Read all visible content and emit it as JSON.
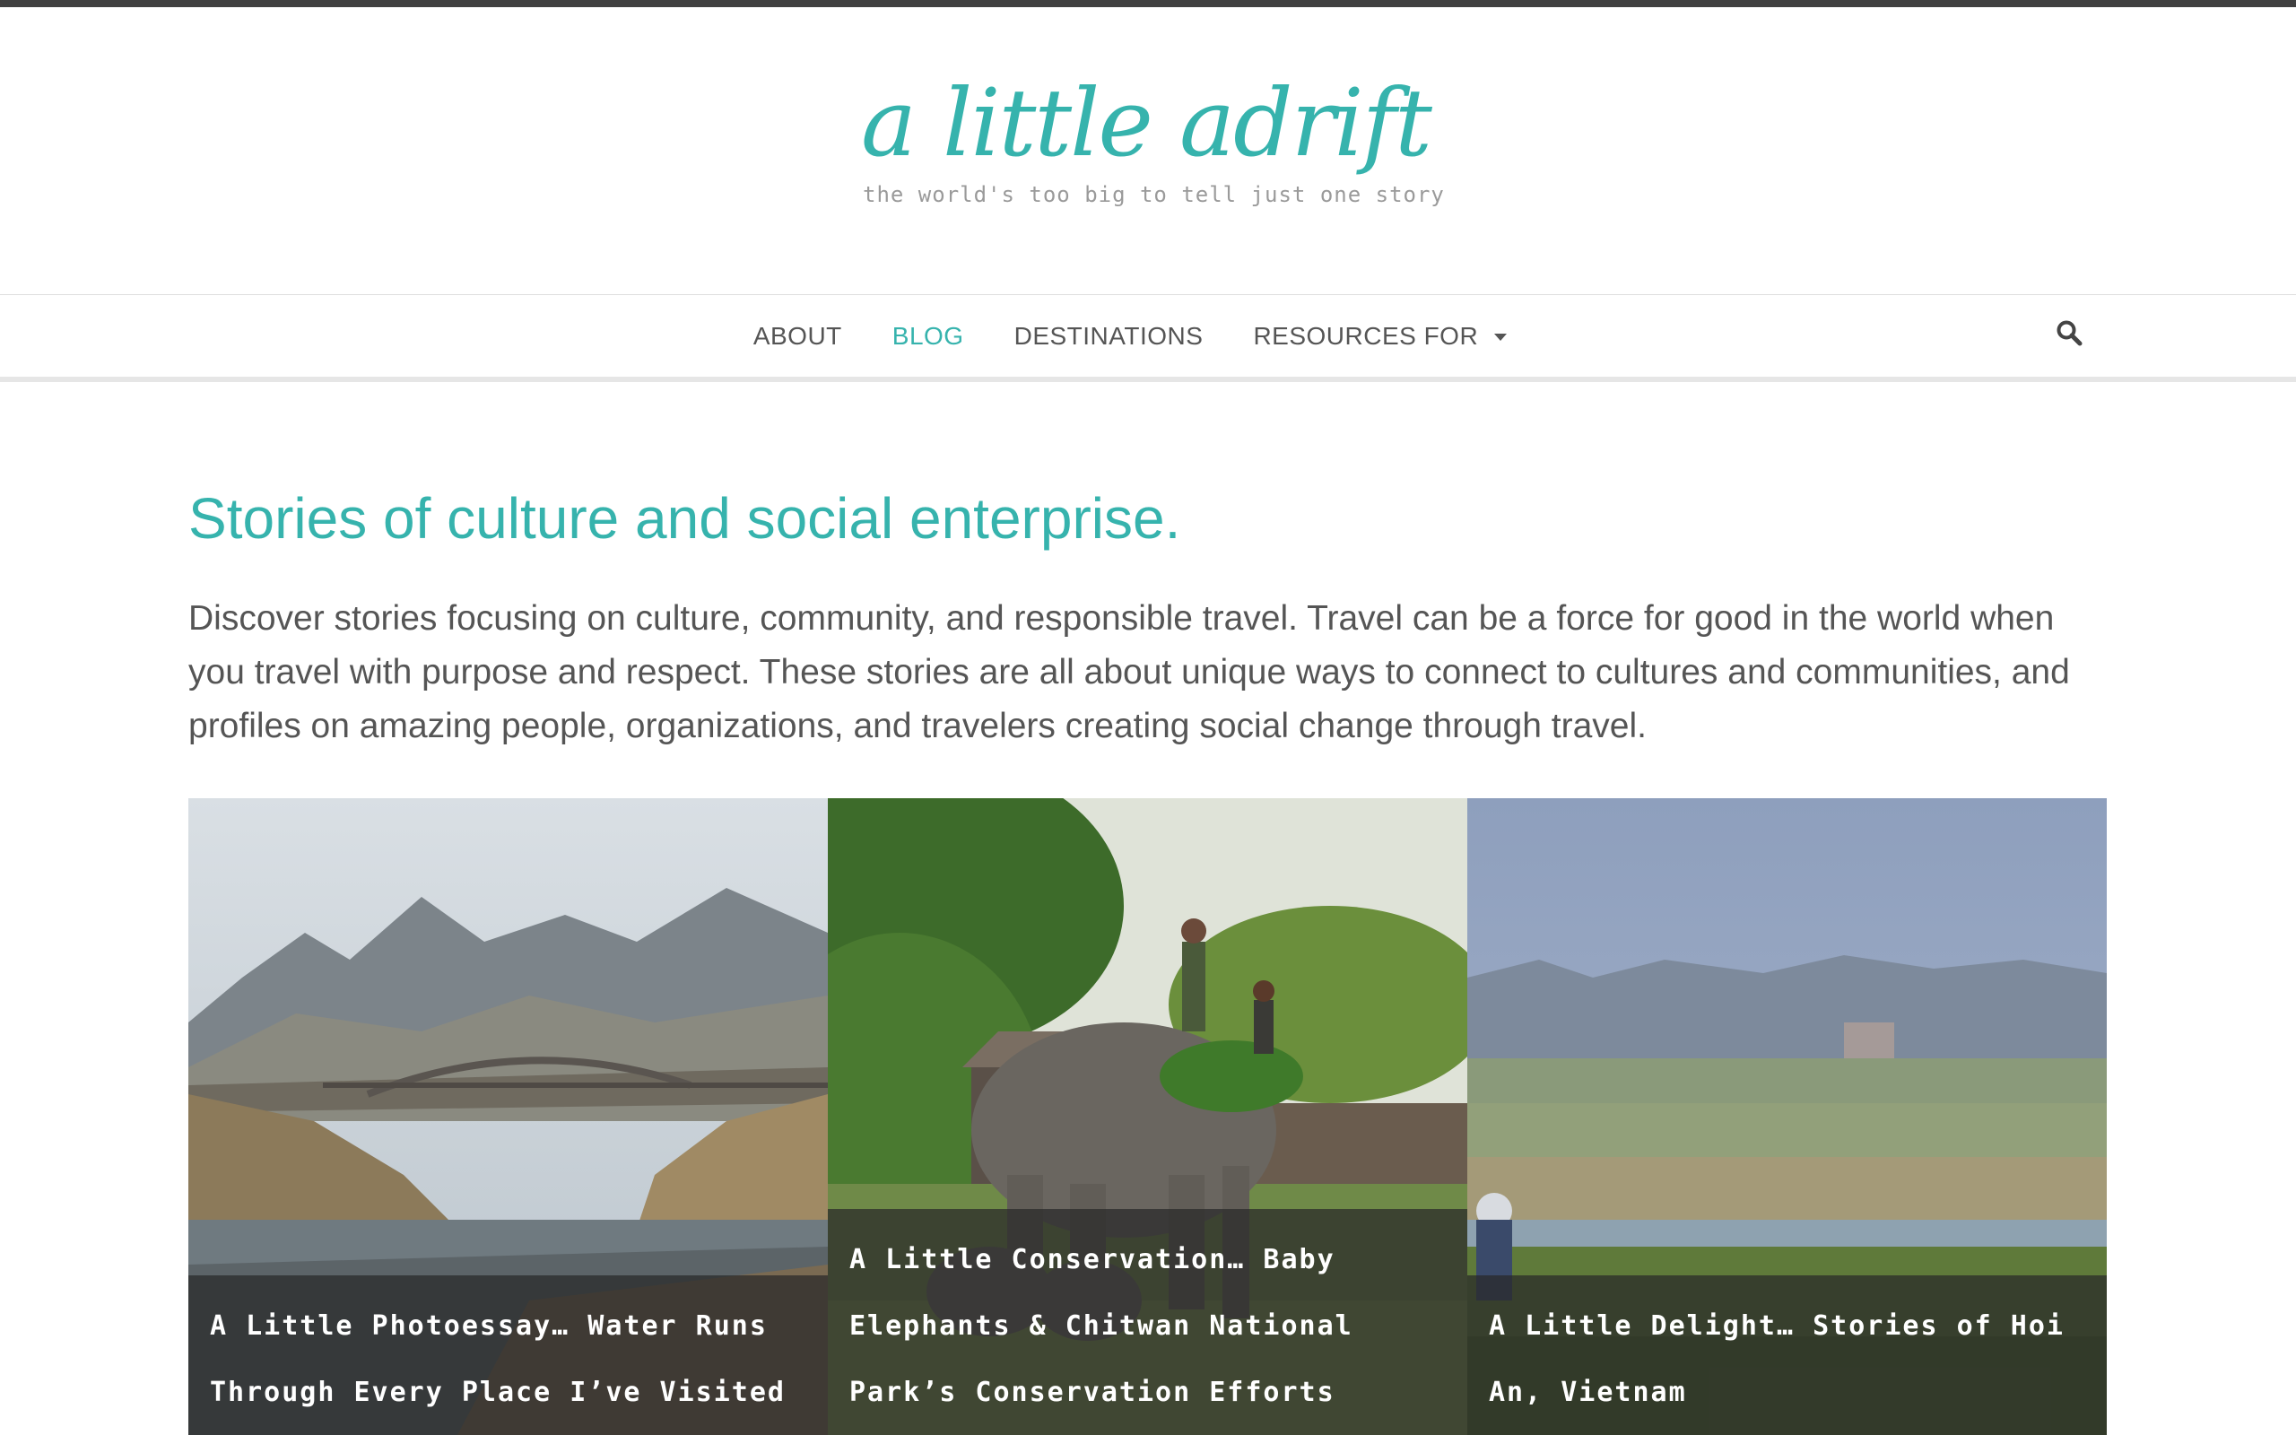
{
  "site": {
    "logo_text": "a little adrift",
    "tagline": "the world's too big to tell just one story"
  },
  "nav": {
    "items": [
      {
        "label": "ABOUT",
        "active": false
      },
      {
        "label": "BLOG",
        "active": true
      },
      {
        "label": "DESTINATIONS",
        "active": false
      },
      {
        "label": "RESOURCES FOR",
        "active": false,
        "has_dropdown": true
      }
    ],
    "search_icon": "search-icon"
  },
  "page": {
    "headline": "Stories of culture and social enterprise.",
    "intro": "Discover stories focusing on culture, community, and responsible travel. Travel can be a force for good in the world when you travel with purpose and respect. These stories are all about unique ways to connect to cultures and communities, and profiles on amazing people, organizations, and travelers creating social change through travel."
  },
  "posts": [
    {
      "title": "A Little Photoessay… Water Runs Through Every Place I’ve Visited"
    },
    {
      "title": "A Little Conservation… Baby Elephants & Chitwan National Park’s Conservation Efforts"
    },
    {
      "title": "A Little Delight… Stories of Hoi An, Vietnam"
    }
  ],
  "colors": {
    "accent": "#36b3ad",
    "text": "#555555",
    "topbar": "#404040"
  }
}
